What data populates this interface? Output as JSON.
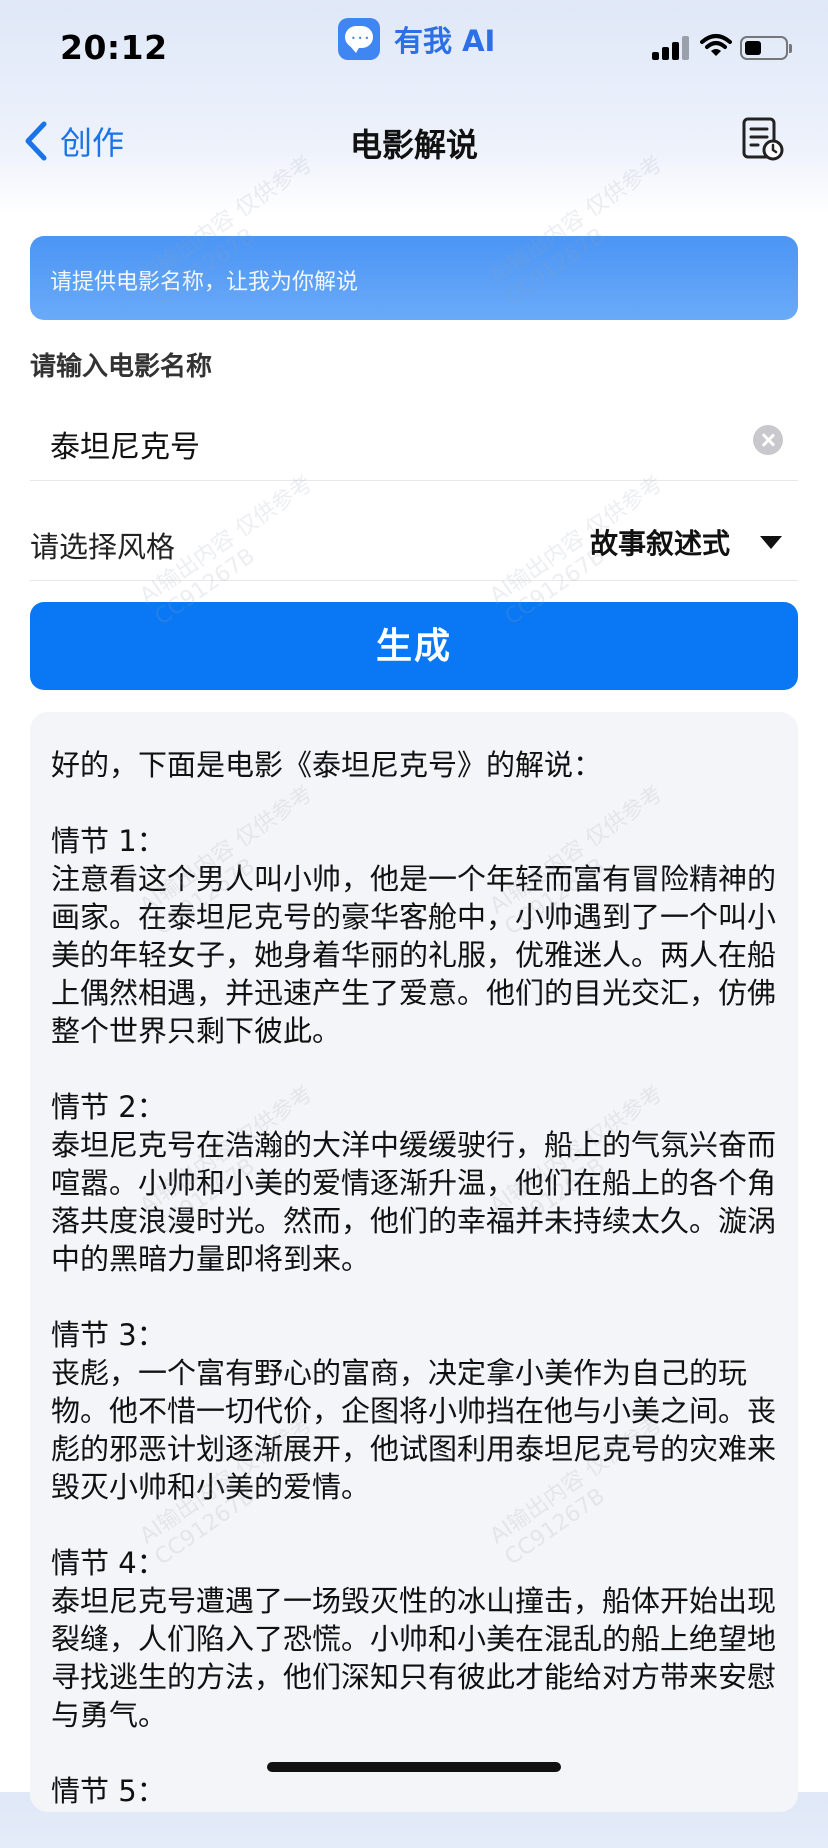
{
  "status_bar": {
    "time": "20:12",
    "app_name": "有我 AI",
    "icons": [
      "signal-icon",
      "wifi-icon",
      "battery-icon"
    ]
  },
  "nav": {
    "back_label": "创作",
    "title": "电影解说",
    "history_icon": "history-list-icon"
  },
  "banner": {
    "text": "请提供电影名称，让我为你解说"
  },
  "form": {
    "movie_label": "请输入电影名称",
    "movie_value": "泰坦尼克号",
    "style_label": "请选择风格",
    "style_value": "故事叙述式",
    "generate_label": "生成"
  },
  "result": {
    "intro": "好的，下面是电影《泰坦尼克号》的解说：",
    "sections": [
      {
        "heading": "情节 1：",
        "body": "注意看这个男人叫小帅，他是一个年轻而富有冒险精神的画家。在泰坦尼克号的豪华客舱中，小帅遇到了一个叫小美的年轻女子，她身着华丽的礼服，优雅迷人。两人在船上偶然相遇，并迅速产生了爱意。他们的目光交汇，仿佛整个世界只剩下彼此。"
      },
      {
        "heading": "情节 2：",
        "body": "泰坦尼克号在浩瀚的大洋中缓缓驶行，船上的气氛兴奋而喧嚣。小帅和小美的爱情逐渐升温，他们在船上的各个角落共度浪漫时光。然而，他们的幸福并未持续太久。漩涡中的黑暗力量即将到来。"
      },
      {
        "heading": "情节 3：",
        "body": "丧彪，一个富有野心的富商，决定拿小美作为自己的玩物。他不惜一切代价，企图将小帅挡在他与小美之间。丧彪的邪恶计划逐渐展开，他试图利用泰坦尼克号的灾难来毁灭小帅和小美的爱情。"
      },
      {
        "heading": "情节 4：",
        "body": "泰坦尼克号遭遇了一场毁灭性的冰山撞击，船体开始出现裂缝，人们陷入了恐慌。小帅和小美在混乱的船上绝望地寻找逃生的方法，他们深知只有彼此才能给对方带来安慰与勇气。"
      },
      {
        "heading": "情节 5：",
        "body": ""
      }
    ]
  },
  "watermark": {
    "line1": "AI输出内容 仅供参考",
    "line2": "CC91267B"
  },
  "colors": {
    "accent": "#0a78f5",
    "back_blue": "#1a73e8",
    "banner_top": "#4b95f5",
    "card_bg": "#f4f5f8"
  }
}
